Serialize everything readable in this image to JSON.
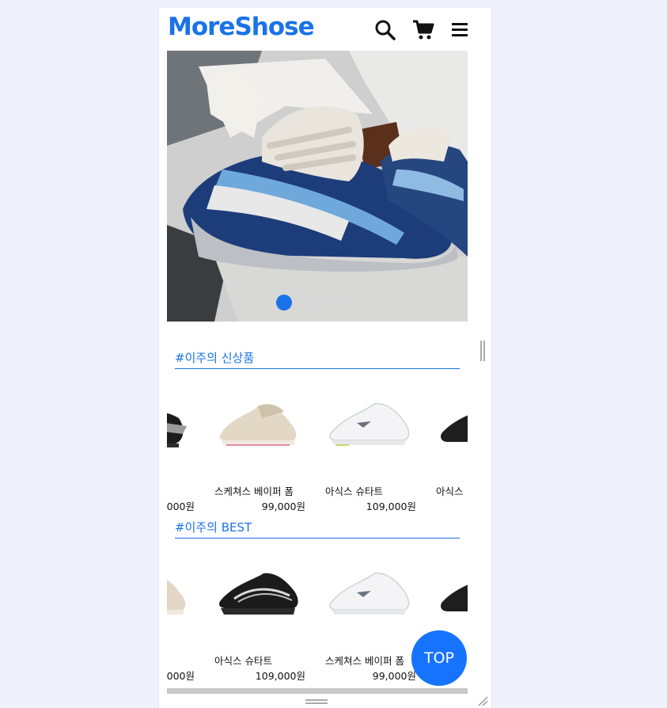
{
  "header": {
    "logo": "MoreShose",
    "icons": [
      "search-icon",
      "cart-icon",
      "menu-icon"
    ]
  },
  "carousel": {
    "slide_count": 4,
    "active_index": 0
  },
  "sections": [
    {
      "title": "#이주의 신상품",
      "products": [
        {
          "name": "",
          "price": ",000원"
        },
        {
          "name": "스케쳐스 베이퍼 폼",
          "price": "99,000원"
        },
        {
          "name": "아식스 슈타트",
          "price": "109,000원"
        },
        {
          "name": "아식스",
          "price": ""
        }
      ]
    },
    {
      "title": "#이주의 BEST",
      "products": [
        {
          "name": "",
          "price": ",000원"
        },
        {
          "name": "아식스 슈타트",
          "price": "109,000원"
        },
        {
          "name": "스케쳐스 베이퍼 폼",
          "price": "99,000원"
        },
        {
          "name": "",
          "price": ""
        }
      ]
    }
  ],
  "top_button": "TOP",
  "colors": {
    "accent": "#1a73e8",
    "top_button": "#1673ff",
    "background": "#eef1f9"
  }
}
